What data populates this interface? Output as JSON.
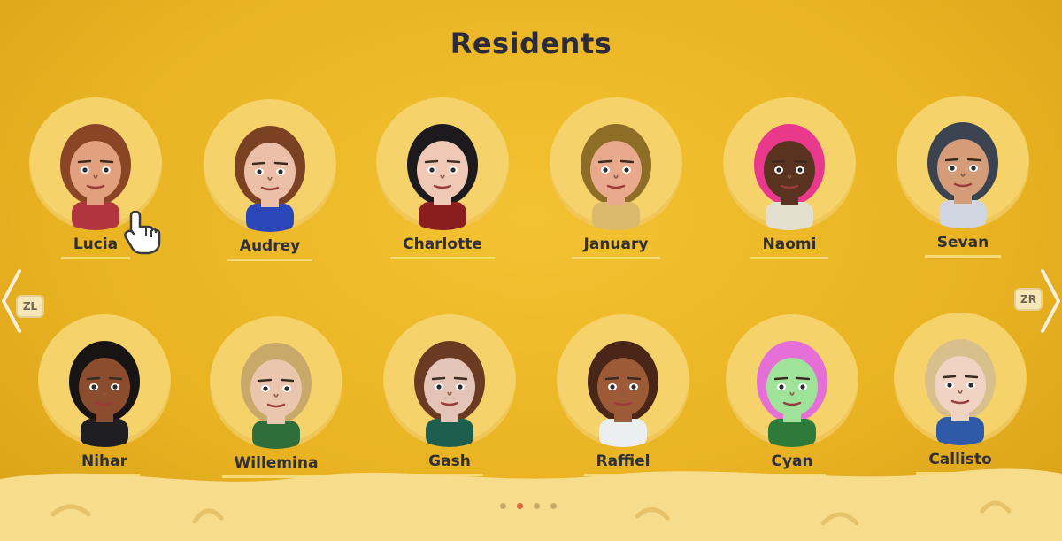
{
  "header": {
    "title": "Residents"
  },
  "residents": [
    {
      "name": "Lucia",
      "hair": "#8a4526",
      "skin": "#e3a07e",
      "shirt": "#b0353f",
      "selected": true
    },
    {
      "name": "Audrey",
      "hair": "#7a4123",
      "skin": "#ecc0a8",
      "shirt": "#2b46b8",
      "selected": false
    },
    {
      "name": "Charlotte",
      "hair": "#1c1a1c",
      "skin": "#efc9b6",
      "shirt": "#8a1e1e",
      "selected": false
    },
    {
      "name": "January",
      "hair": "#8e6d26",
      "skin": "#e9a98c",
      "shirt": "#d9b96b",
      "selected": false
    },
    {
      "name": "Naomi",
      "hair": "#e8398c",
      "skin": "#5a3220",
      "shirt": "#e4e0cf",
      "selected": false
    },
    {
      "name": "Sevan",
      "hair": "#3b4250",
      "skin": "#d49c78",
      "shirt": "#cfd6e0",
      "selected": false
    },
    {
      "name": "Nihar",
      "hair": "#181414",
      "skin": "#8b4d2e",
      "shirt": "#1d1d22",
      "selected": false
    },
    {
      "name": "Willemina",
      "hair": "#c9a96a",
      "skin": "#e9c6ad",
      "shirt": "#2f6e3a",
      "selected": false
    },
    {
      "name": "Gash",
      "hair": "#6b3a22",
      "skin": "#e4c4b6",
      "shirt": "#1d5e4f",
      "selected": false
    },
    {
      "name": "Raffiel",
      "hair": "#4a2618",
      "skin": "#9c5a36",
      "shirt": "#eceff2",
      "selected": false
    },
    {
      "name": "Cyan",
      "hair": "#e56fd6",
      "skin": "#9fe39a",
      "shirt": "#2e7a38",
      "selected": false
    },
    {
      "name": "Callisto",
      "hair": "#d8c08c",
      "skin": "#f0d3c2",
      "shirt": "#2e5aa8",
      "selected": false
    }
  ],
  "controls": {
    "prev_button": "ZL",
    "next_button": "ZR"
  },
  "pagination": {
    "pages": 4,
    "current": 2
  },
  "colors": {
    "background": "#e9b322",
    "portrait_bg": "#f6d36a",
    "title": "#2b2b3a",
    "active_dot": "#e0643a"
  }
}
